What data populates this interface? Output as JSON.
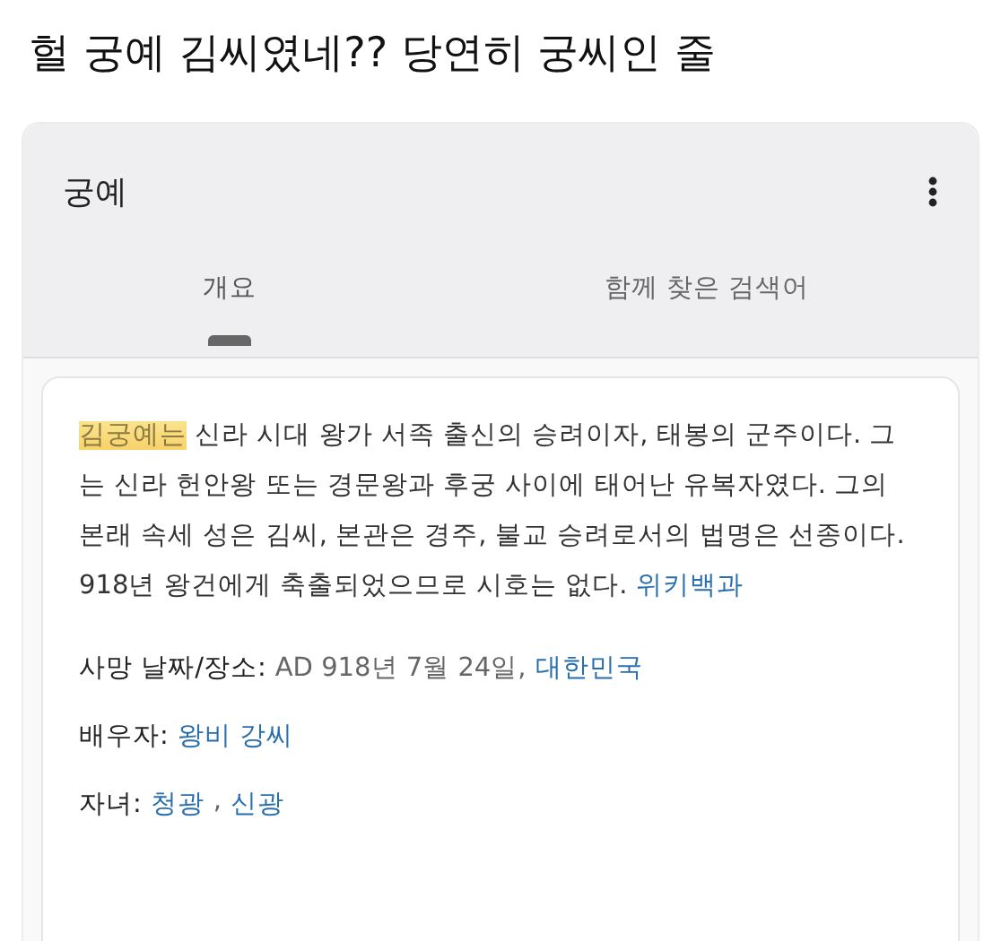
{
  "post_title": "헐 궁예 김씨였네?? 당연히 궁씨인 줄",
  "panel": {
    "title": "궁예",
    "tabs": [
      {
        "label": "개요",
        "selected": true
      },
      {
        "label": "함께 찾은 검색어",
        "selected": false
      }
    ],
    "description": {
      "highlight": "김궁예는",
      "text": " 신라 시대 왕가 서족 출신의 승려이자, 태봉의 군주이다. 그는 신라 헌안왕 또는 경문왕과 후궁 사이에 태어난 유복자였다. 그의 본래 속세 성은 김씨, 본관은 경주, 불교 승려로서의 법명은 선종이다. 918년 왕건에게 축출되었으므로 시호는 없다.",
      "source": "위키백과"
    },
    "facts": [
      {
        "label": "사망 날짜/장소:",
        "parts": [
          {
            "kind": "text",
            "text": "AD 918년 7월 24일,"
          },
          {
            "kind": "link",
            "text": "대한민국"
          }
        ]
      },
      {
        "label": "배우자:",
        "parts": [
          {
            "kind": "link",
            "text": "왕비 강씨"
          }
        ]
      },
      {
        "label": "자녀:",
        "parts": [
          {
            "kind": "link",
            "text": "청광"
          },
          {
            "kind": "text",
            "text": ","
          },
          {
            "kind": "link",
            "text": "신광"
          }
        ]
      }
    ]
  }
}
